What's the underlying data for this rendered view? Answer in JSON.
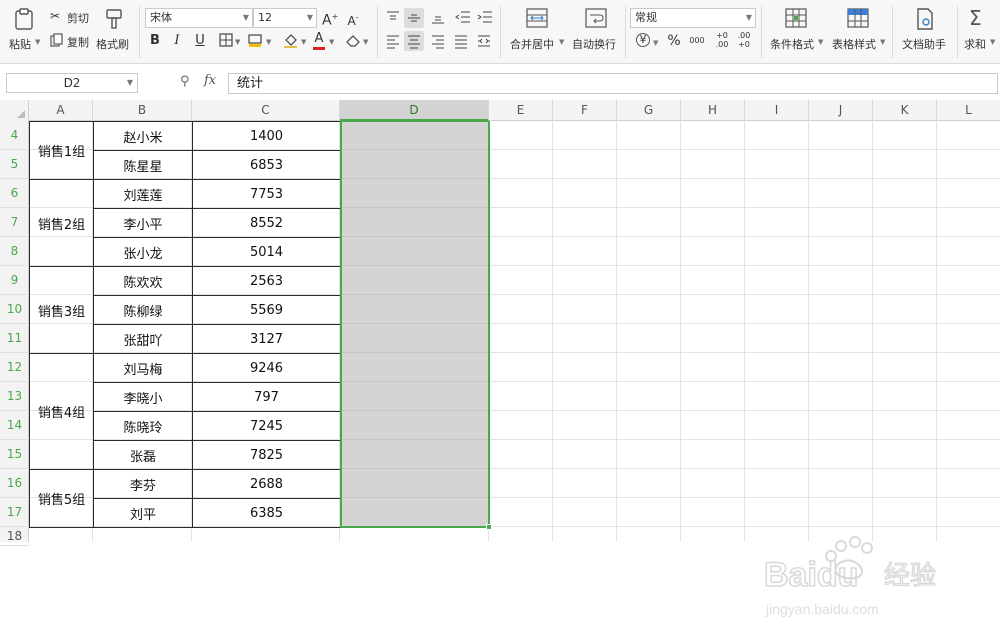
{
  "ribbon": {
    "paste": "粘贴",
    "cut": "剪切",
    "copy": "复制",
    "format_painter": "格式刷",
    "font_name": "宋体",
    "font_size": "12",
    "bold": "B",
    "italic": "I",
    "underline": "U",
    "font_color_letter": "A",
    "merge_center": "合并居中",
    "wrap_text": "自动换行",
    "number_format": "常规",
    "percent": "%",
    "thousands": "000",
    "dec_inc": "+0 .00",
    "dec_dec": ".00 +0",
    "conditional_format": "条件格式",
    "table_style": "表格样式",
    "doc_assistant": "文档助手",
    "sum": "求和"
  },
  "formula_bar": {
    "name_box": "D2",
    "fx": "fx",
    "formula": "统计"
  },
  "columns": [
    "A",
    "B",
    "C",
    "D",
    "E",
    "F",
    "G",
    "H",
    "I",
    "J",
    "K",
    "L"
  ],
  "rows": [
    "4",
    "5",
    "6",
    "7",
    "8",
    "9",
    "10",
    "11",
    "12",
    "13",
    "14",
    "15",
    "16",
    "17",
    "18"
  ],
  "groups": [
    "销售1组",
    "销售2组",
    "销售3组",
    "销售4组",
    "销售5组"
  ],
  "names": [
    "赵小米",
    "陈星星",
    "刘莲莲",
    "李小平",
    "张小龙",
    "陈欢欢",
    "陈柳绿",
    "张甜吖",
    "刘马梅",
    "李晓小",
    "陈晓玲",
    "张磊",
    "李芬",
    "刘平"
  ],
  "values": [
    "1400",
    "6853",
    "7753",
    "8552",
    "5014",
    "2563",
    "5569",
    "3127",
    "9246",
    "797",
    "7245",
    "7825",
    "2688",
    "6385"
  ],
  "watermark": {
    "brand": "Baidu",
    "cn": "经验",
    "url": "jingyan.baidu.com"
  },
  "colors": {
    "select_green": "#4aa84a",
    "select_fill": "#d4d4d4",
    "font_red": "#e02020"
  }
}
